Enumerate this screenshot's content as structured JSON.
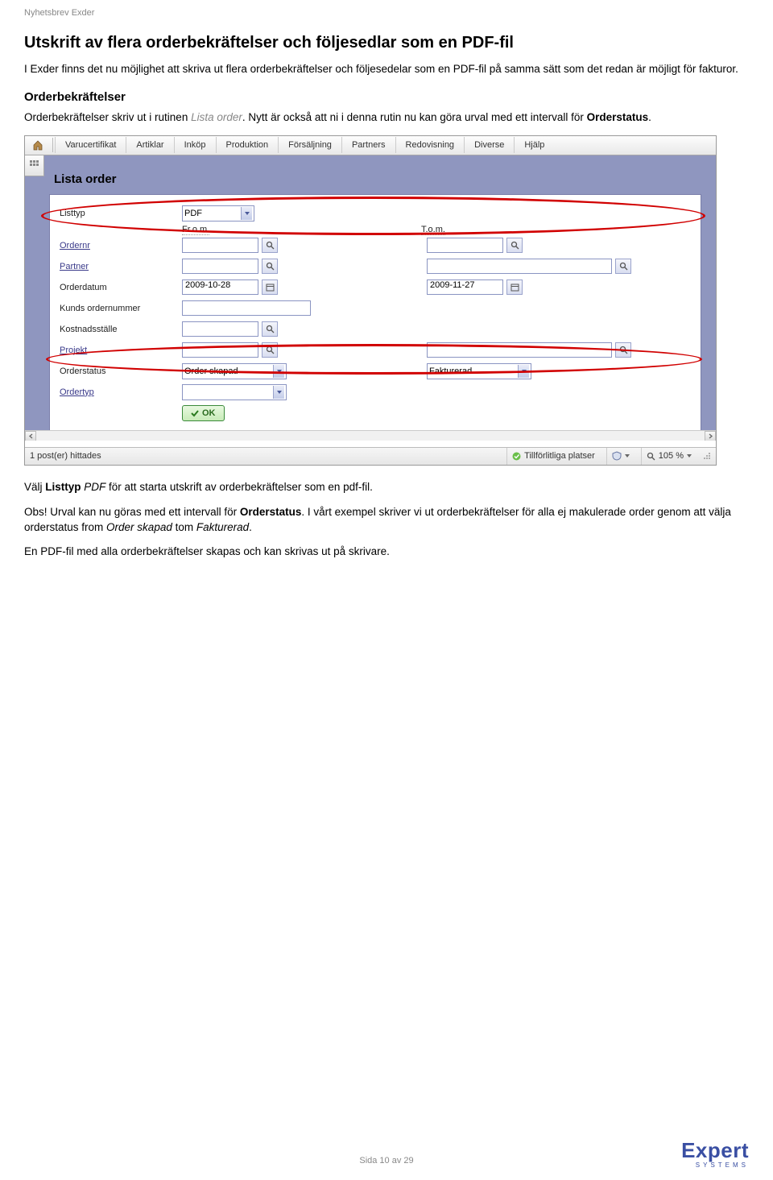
{
  "header_label": "Nyhetsbrev Exder",
  "h1": "Utskrift av flera orderbekräftelser och följesedlar som en PDF-fil",
  "intro": "I Exder finns det nu möjlighet att skriva ut flera orderbekräftelser och följesedelar som en PDF-fil på samma sätt som det redan är möjligt för fakturor.",
  "h2": "Orderbekräftelser",
  "p2_pre": "Orderbekräftelser skriv ut i rutinen ",
  "p2_link": "Lista order",
  "p2_post1": ". Nytt är också att ni i denna rutin nu kan göra urval med ett intervall för ",
  "p2_bold": "Orderstatus",
  "p2_post2": ".",
  "after1_pre": "Välj ",
  "after1_b": "Listtyp",
  "after1_mid": " ",
  "after1_i": "PDF",
  "after1_post": " för att starta utskrift av orderbekräftelser som en pdf-fil.",
  "after2_pre": "Obs! Urval kan nu göras med ett intervall för ",
  "after2_b": "Orderstatus",
  "after2_mid": ". I vårt exempel skriver vi ut orderbekräftelser för alla ej makulerade order genom att välja orderstatus from ",
  "after2_i1": "Order skapad",
  "after2_mid2": " tom ",
  "after2_i2": "Fakturerad",
  "after2_post": ".",
  "after3": "En PDF-fil med alla orderbekräftelser skapas och kan skrivas ut på skrivare.",
  "menubar": [
    "Varucertifikat",
    "Artiklar",
    "Inköp",
    "Produktion",
    "Försäljning",
    "Partners",
    "Redovisning",
    "Diverse",
    "Hjälp"
  ],
  "panel_title": "Lista order",
  "labels": {
    "listtyp": "Listtyp",
    "ordernr": "Ordernr",
    "partner": "Partner",
    "orderdatum": "Orderdatum",
    "kunds": "Kunds ordernummer",
    "kost": "Kostnadsställe",
    "projekt": "Projekt",
    "orderstatus": "Orderstatus",
    "ordertyp": "Ordertyp",
    "from": "Fr.o.m.",
    "tom": "T.o.m."
  },
  "values": {
    "listtyp": "PDF",
    "orderdatum_from": "2009-10-28",
    "orderdatum_tom": "2009-11-27",
    "orderstatus_from": "Order skapad",
    "orderstatus_tom": "Fakturerad",
    "ok": "OK"
  },
  "statusbar": {
    "left": "1 post(er) hittades",
    "trust": "Tillförlitliga platser",
    "zoom": "105 %"
  },
  "footer": "Sida 10 av 29",
  "logo": {
    "main": "Expert",
    "sub": "SYSTEMS"
  }
}
